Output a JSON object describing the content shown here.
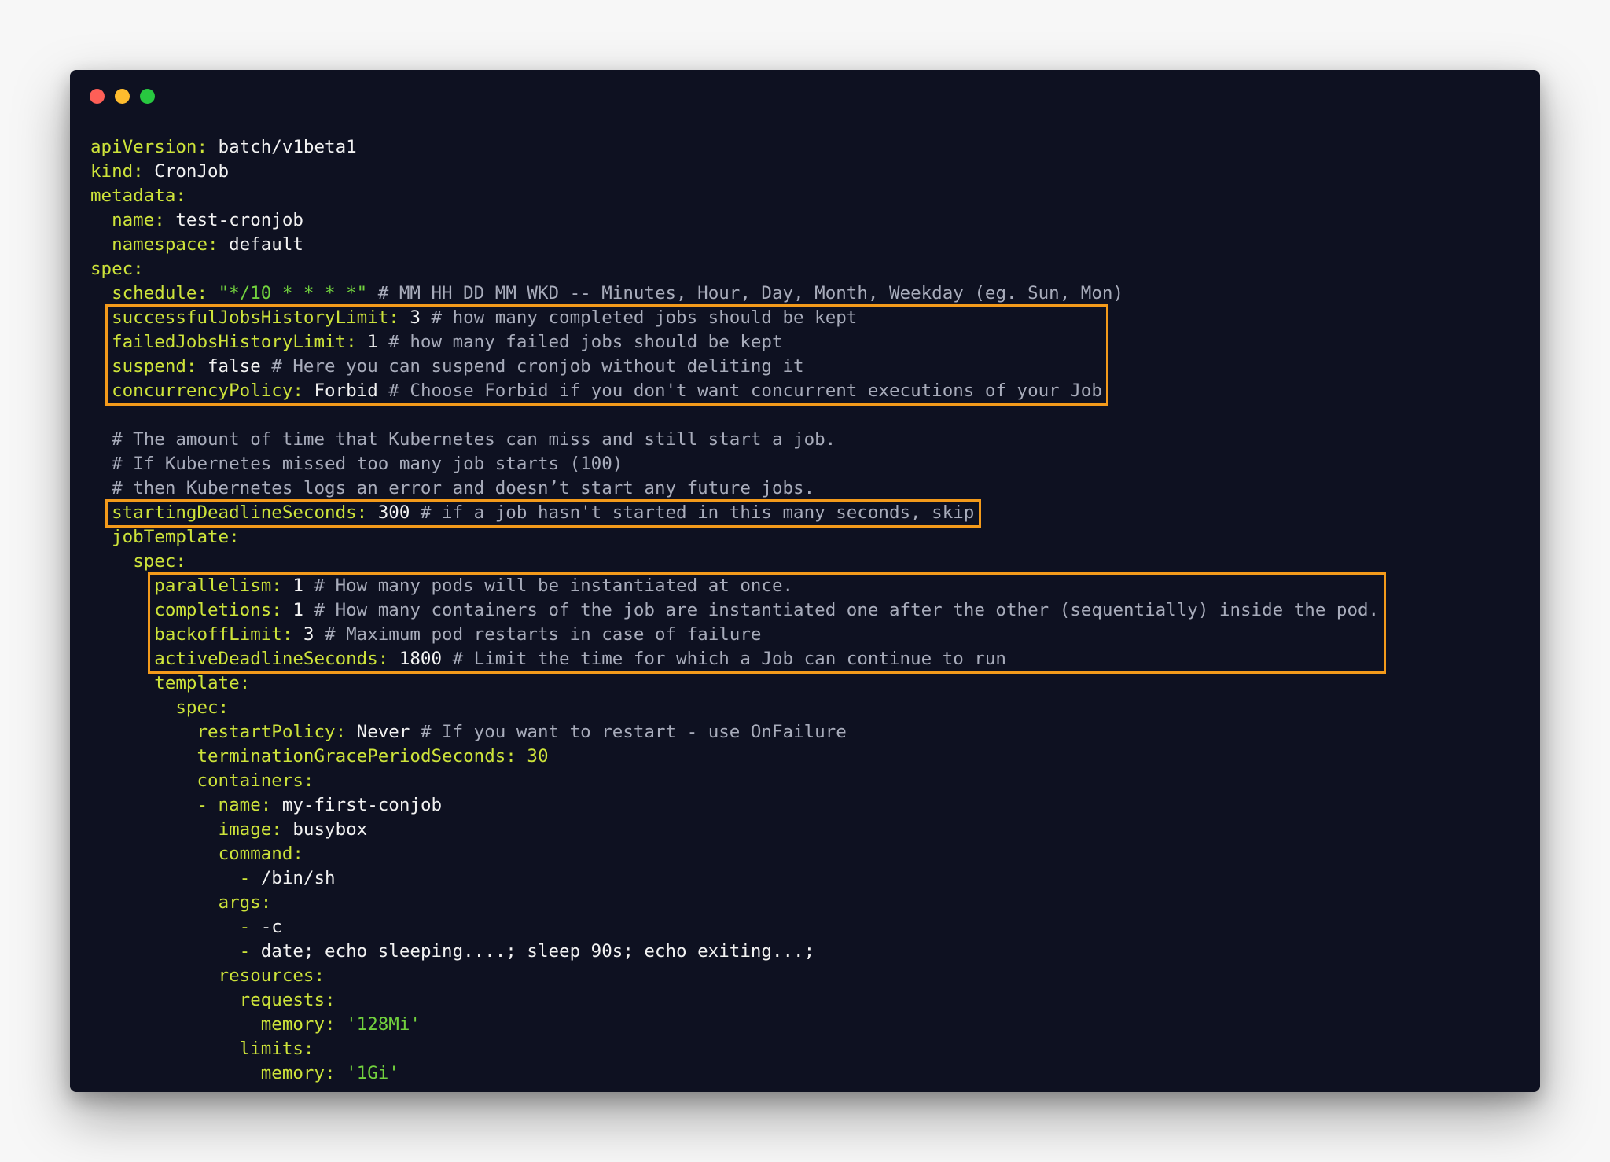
{
  "window": {
    "controls": {
      "close": "close-dot",
      "minimize": "minimize-dot",
      "maximize": "maximize-dot",
      "colors": {
        "close": "#fe5f57",
        "minimize": "#febc2e",
        "maximize": "#28c840"
      }
    },
    "background": "#0e1121"
  },
  "colors": {
    "key": "#cde33a",
    "value": "#f2f2f2",
    "string": "#72d23e",
    "comment": "#a8acbb",
    "highlight_border": "#f39a1b"
  },
  "code": {
    "lines": [
      {
        "indent": "",
        "key": "apiVersion:",
        "value": " batch/v1beta1",
        "str": "",
        "comment": ""
      },
      {
        "indent": "",
        "key": "kind:",
        "value": " CronJob",
        "str": "",
        "comment": ""
      },
      {
        "indent": "",
        "key": "metadata:",
        "value": "",
        "str": "",
        "comment": ""
      },
      {
        "indent": "  ",
        "key": "name:",
        "value": " test-cronjob",
        "str": "",
        "comment": ""
      },
      {
        "indent": "  ",
        "key": "namespace:",
        "value": " default",
        "str": "",
        "comment": ""
      },
      {
        "indent": "",
        "key": "spec:",
        "value": "",
        "str": "",
        "comment": ""
      },
      {
        "indent": "  ",
        "key": "schedule:",
        "value": " ",
        "str": "\"*/10 * * * *\"",
        "comment": " # MM HH DD MM WKD -- Minutes, Hour, Day, Month, Weekday (eg. Sun, Mon)"
      },
      {
        "indent": "  ",
        "key": "successfulJobsHistoryLimit:",
        "value": " 3",
        "str": "",
        "comment": " # how many completed jobs should be kept"
      },
      {
        "indent": "  ",
        "key": "failedJobsHistoryLimit:",
        "value": " 1",
        "str": "",
        "comment": " # how many failed jobs should be kept"
      },
      {
        "indent": "  ",
        "key": "suspend:",
        "value": " false",
        "str": "",
        "comment": " # Here you can suspend cronjob without deliting it"
      },
      {
        "indent": "  ",
        "key": "concurrencyPolicy:",
        "value": " Forbid",
        "str": "",
        "comment": " # Choose Forbid if you don't want concurrent executions of your Job"
      },
      {
        "indent": "",
        "key": "",
        "value": "",
        "str": "",
        "comment": ""
      },
      {
        "indent": "  ",
        "key": "",
        "value": "",
        "str": "",
        "comment": "# The amount of time that Kubernetes can miss and still start a job."
      },
      {
        "indent": "  ",
        "key": "",
        "value": "",
        "str": "",
        "comment": "# If Kubernetes missed too many job starts (100)"
      },
      {
        "indent": "  ",
        "key": "",
        "value": "",
        "str": "",
        "comment": "# then Kubernetes logs an error and doesn’t start any future jobs."
      },
      {
        "indent": "  ",
        "key": "startingDeadlineSeconds:",
        "value": " 300",
        "str": "",
        "comment": " # if a job hasn't started in this many seconds, skip"
      },
      {
        "indent": "  ",
        "key": "jobTemplate:",
        "value": "",
        "str": "",
        "comment": ""
      },
      {
        "indent": "    ",
        "key": "spec:",
        "value": "",
        "str": "",
        "comment": ""
      },
      {
        "indent": "      ",
        "key": "parallelism:",
        "value": " 1",
        "str": "",
        "comment": " # How many pods will be instantiated at once."
      },
      {
        "indent": "      ",
        "key": "completions:",
        "value": " 1",
        "str": "",
        "comment": " # How many containers of the job are instantiated one after the other (sequentially) inside the pod."
      },
      {
        "indent": "      ",
        "key": "backoffLimit:",
        "value": " 3",
        "str": "",
        "comment": " # Maximum pod restarts in case of failure"
      },
      {
        "indent": "      ",
        "key": "activeDeadlineSeconds:",
        "value": " 1800",
        "str": "",
        "comment": " # Limit the time for which a Job can continue to run"
      },
      {
        "indent": "      ",
        "key": "template:",
        "value": "",
        "str": "",
        "comment": ""
      },
      {
        "indent": "        ",
        "key": "spec:",
        "value": "",
        "str": "",
        "comment": ""
      },
      {
        "indent": "          ",
        "key": "restartPolicy:",
        "value": " Never",
        "str": "",
        "comment": " # If you want to restart - use OnFailure"
      },
      {
        "indent": "          ",
        "key": "terminationGracePeriodSeconds: 30",
        "value": "",
        "str": "",
        "comment": ""
      },
      {
        "indent": "          ",
        "key": "containers:",
        "value": "",
        "str": "",
        "comment": ""
      },
      {
        "indent": "          ",
        "key": "- name:",
        "value": " my-first-conjob",
        "str": "",
        "comment": ""
      },
      {
        "indent": "            ",
        "key": "image:",
        "value": " busybox",
        "str": "",
        "comment": ""
      },
      {
        "indent": "            ",
        "key": "command:",
        "value": "",
        "str": "",
        "comment": ""
      },
      {
        "indent": "              ",
        "key": "-",
        "value": " /bin/sh",
        "str": "",
        "comment": ""
      },
      {
        "indent": "            ",
        "key": "args:",
        "value": "",
        "str": "",
        "comment": ""
      },
      {
        "indent": "              ",
        "key": "-",
        "value": " -c",
        "str": "",
        "comment": ""
      },
      {
        "indent": "              ",
        "key": "-",
        "value": " date; echo sleeping....; sleep 90s; echo exiting...;",
        "str": "",
        "comment": ""
      },
      {
        "indent": "            ",
        "key": "resources:",
        "value": "",
        "str": "",
        "comment": ""
      },
      {
        "indent": "              ",
        "key": "requests:",
        "value": "",
        "str": "",
        "comment": ""
      },
      {
        "indent": "                ",
        "key": "memory:",
        "value": " ",
        "str": "'128Mi'",
        "comment": ""
      },
      {
        "indent": "              ",
        "key": "limits:",
        "value": "",
        "str": "",
        "comment": ""
      },
      {
        "indent": "                ",
        "key": "memory:",
        "value": " ",
        "str": "'1Gi'",
        "comment": ""
      }
    ]
  },
  "highlights": [
    {
      "label": "cronjob-limits-box",
      "from_line": 7,
      "to_line": 10
    },
    {
      "label": "starting-deadline-box",
      "from_line": 15,
      "to_line": 15
    },
    {
      "label": "job-spec-box",
      "from_line": 18,
      "to_line": 21
    }
  ]
}
